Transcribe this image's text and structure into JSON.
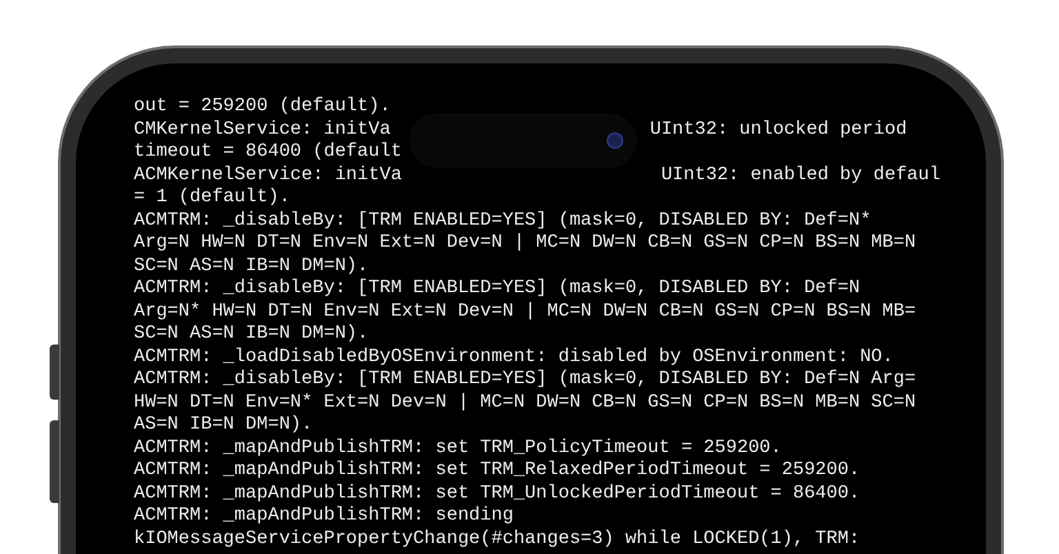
{
  "terminal": {
    "lines": [
      {
        "text": "out = 259200 (default)."
      },
      {
        "text": "CMKernelService: initVa",
        "hidden_right": "UInt32: unlocked period"
      },
      {
        "text": "timeout = 86400 (default"
      },
      {
        "text": "ACMKernelService: initVa",
        "hidden_right": "UInt32: enabled by defaul"
      },
      {
        "text": "= 1 (default)."
      },
      {
        "text": "ACMTRM: _disableBy: [TRM ENABLED=YES] (mask=0, DISABLED BY: Def=N*"
      },
      {
        "text": "Arg=N HW=N DT=N Env=N Ext=N Dev=N | MC=N DW=N CB=N GS=N CP=N BS=N MB=N"
      },
      {
        "text": "SC=N AS=N IB=N DM=N)."
      },
      {
        "text": "ACMTRM: _disableBy: [TRM ENABLED=YES] (mask=0, DISABLED BY: Def=N"
      },
      {
        "text": "Arg=N* HW=N DT=N Env=N Ext=N Dev=N | MC=N DW=N CB=N GS=N CP=N BS=N MB="
      },
      {
        "text": "SC=N AS=N IB=N DM=N)."
      },
      {
        "text": "ACMTRM: _loadDisabledByOSEnvironment: disabled by OSEnvironment: NO."
      },
      {
        "text": "ACMTRM: _disableBy: [TRM ENABLED=YES] (mask=0, DISABLED BY: Def=N Arg="
      },
      {
        "text": "HW=N DT=N Env=N* Ext=N Dev=N | MC=N DW=N CB=N GS=N CP=N BS=N MB=N SC=N"
      },
      {
        "text": "AS=N IB=N DM=N)."
      },
      {
        "text": "ACMTRM: _mapAndPublishTRM: set TRM_PolicyTimeout = 259200."
      },
      {
        "text": "ACMTRM: _mapAndPublishTRM: set TRM_RelaxedPeriodTimeout = 259200."
      },
      {
        "text": "ACMTRM: _mapAndPublishTRM: set TRM_UnlockedPeriodTimeout = 86400."
      },
      {
        "text": "ACMTRM: _mapAndPublishTRM: sending"
      },
      {
        "text": "kIOMessageServicePropertyChange(#changes=3) while LOCKED(1), TRM:"
      }
    ]
  }
}
